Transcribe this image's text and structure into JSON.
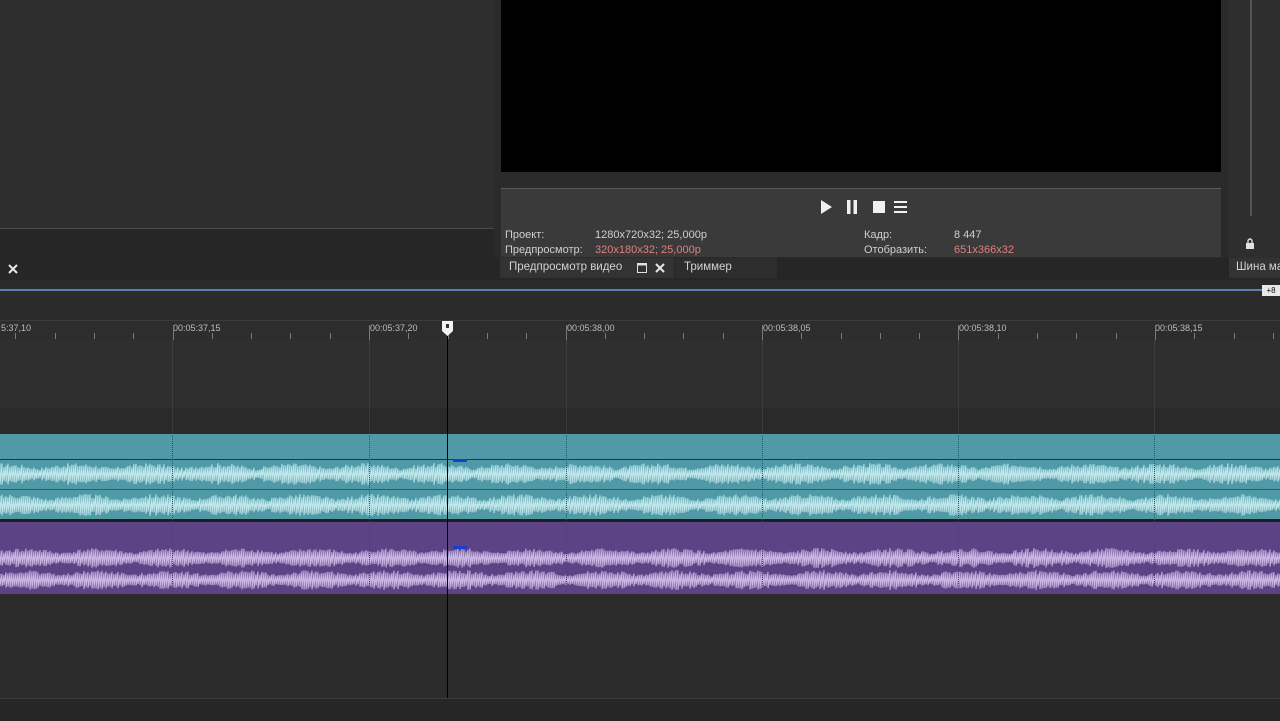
{
  "preview": {
    "project_label": "Проект:",
    "project_value": "1280x720x32; 25,000p",
    "preview_label": "Предпросмотр:",
    "preview_value": "320x180x32; 25,000p",
    "frame_label": "Кадр:",
    "frame_value": "8 447",
    "display_label": "Отобразить:",
    "display_value": "651x366x32"
  },
  "tabs": {
    "video_preview": "Предпросмотр видео",
    "trimmer": "Триммер",
    "master_bus": "Шина ма"
  },
  "timeline": {
    "zoom_badge": "+8",
    "ruler_labels": [
      "5:37,10",
      "00:05:37,15",
      "00:05:37,20",
      "00:05:38,00",
      "00:05:38,05",
      "00:05:38,10",
      "00:05:38,15"
    ]
  },
  "colors": {
    "audio_track_1": "#4f9aa6",
    "audio_wave_1": "#bfe6ea",
    "audio_track_2": "#5c4386",
    "audio_wave_2": "#c9b6e2",
    "status_red": "#e07f7f"
  }
}
